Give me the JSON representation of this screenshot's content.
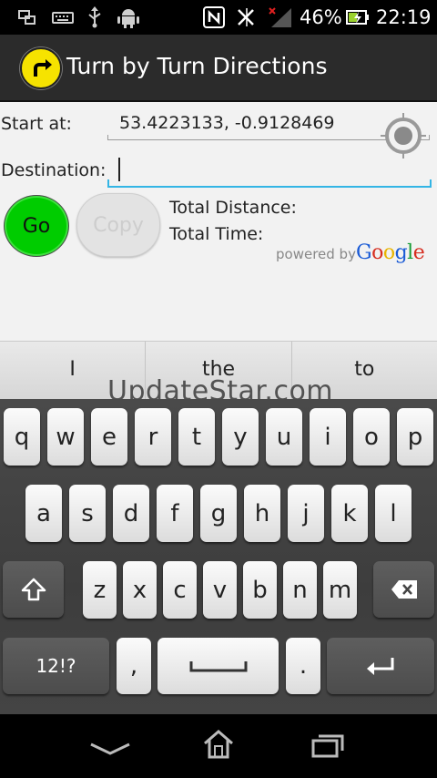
{
  "status_bar": {
    "battery_percent": "46%",
    "time": "22:19",
    "icons": [
      "screenshot-icon",
      "keyboard-icon",
      "usb-icon",
      "android-debug-icon",
      "nfc-icon",
      "bluetooth-icon",
      "signal-no-sim-icon",
      "battery-charging-icon"
    ]
  },
  "app": {
    "title": "Turn by Turn Directions",
    "logo_color": "#f6e300"
  },
  "form": {
    "start_label": "Start at:",
    "start_value": "53.4223133, -0.9128469",
    "destination_label": "Destination:",
    "destination_value": ""
  },
  "buttons": {
    "go": "Go",
    "copy": "Copy"
  },
  "info": {
    "total_distance_label": "Total Distance:",
    "total_time_label": "Total Time:",
    "powered_by": "powered by",
    "google": [
      "G",
      "o",
      "o",
      "g",
      "l",
      "e"
    ],
    "google_colors": [
      "#1a5bd6",
      "#d62d20",
      "#e8b400",
      "#1a5bd6",
      "#179c36",
      "#d62d20"
    ]
  },
  "suggestions": [
    "I",
    "the",
    "to"
  ],
  "watermark": "UpdateStar.com",
  "keyboard": {
    "row1": [
      "q",
      "w",
      "e",
      "r",
      "t",
      "y",
      "u",
      "i",
      "o",
      "p"
    ],
    "row2": [
      "a",
      "s",
      "d",
      "f",
      "g",
      "h",
      "j",
      "k",
      "l"
    ],
    "row3": [
      "z",
      "x",
      "c",
      "v",
      "b",
      "n",
      "m"
    ],
    "symbols_key": "12!?",
    "comma": ",",
    "period": "."
  },
  "colors": {
    "accent": "#33b5e5",
    "go_button": "#00cc00"
  }
}
